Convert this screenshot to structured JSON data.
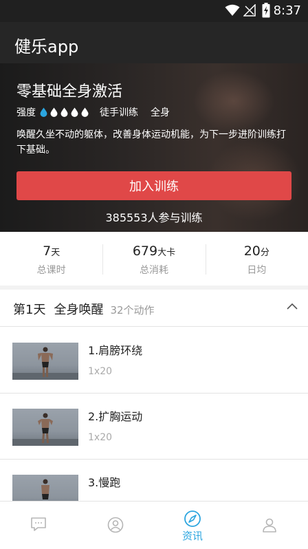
{
  "status_bar": {
    "time": "8:37"
  },
  "app": {
    "title": "健乐app"
  },
  "hero": {
    "title": "零基础全身激活",
    "intensity_label": "强度",
    "intensity_level": 1,
    "intensity_max": 5,
    "tags": [
      "徒手训练",
      "全身"
    ],
    "description": "唤醒久坐不动的躯体，改善身体运动机能，为下一步进阶训练打下基础。",
    "join_button": "加入训练",
    "participants": "385553人参与训练"
  },
  "colors": {
    "accent": "#e04848",
    "active_nav": "#2ba5df",
    "drop_active": "#2ba5df",
    "drop_inactive": "#ffffff"
  },
  "stats": [
    {
      "value": "7",
      "unit": "天",
      "label": "总课时"
    },
    {
      "value": "679",
      "unit": "大卡",
      "label": "总消耗"
    },
    {
      "value": "20",
      "unit": "分",
      "label": "日均"
    }
  ],
  "day": {
    "day": "第1天",
    "name": "全身唤醒",
    "count": "32个动作"
  },
  "exercises": [
    {
      "name": "1.肩膀环绕",
      "reps": "1x20"
    },
    {
      "name": "2.扩胸运动",
      "reps": "1x20"
    },
    {
      "name": "3.慢跑",
      "reps": ""
    }
  ],
  "nav": [
    {
      "icon": "message-icon",
      "label": ""
    },
    {
      "icon": "face-icon",
      "label": ""
    },
    {
      "icon": "compass-icon",
      "label": "资讯",
      "active": true
    },
    {
      "icon": "person-icon",
      "label": ""
    }
  ]
}
